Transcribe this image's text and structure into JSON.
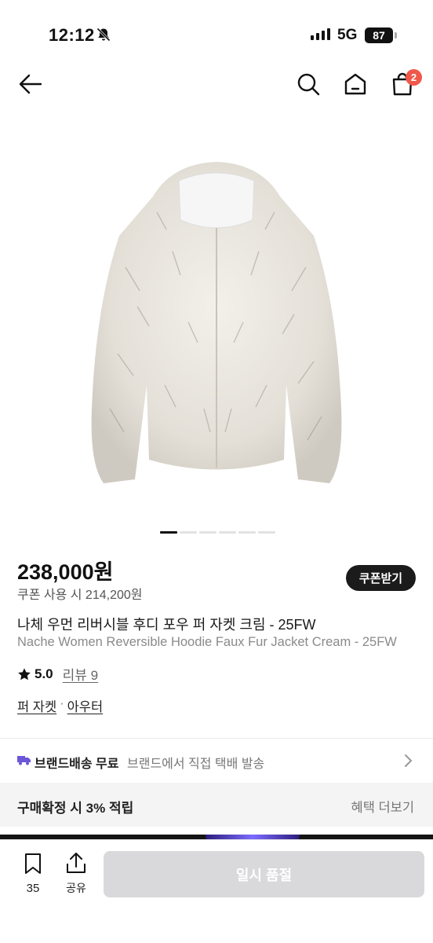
{
  "status_bar": {
    "time": "12:12",
    "network": "5G",
    "battery": "87"
  },
  "nav": {
    "cart_badge": "2"
  },
  "product": {
    "price": "238,000원",
    "coupon_price": "쿠폰 사용 시 214,200원",
    "coupon_button": "쿠폰받기",
    "title_ko": "나체 우먼 리버시블 후디 포우 퍼 자켓 크림 - 25FW",
    "title_en": "Nache Women Reversible Hoodie Faux Fur Jacket Cream - 25FW",
    "rating": "5.0",
    "review_label": "리뷰 9",
    "category_1": "퍼 자켓",
    "category_sep": "·",
    "category_2": "아우터",
    "image_pages": 6,
    "image_active_page": 1
  },
  "shipping": {
    "bold": "브랜드배송 무료",
    "sub": "브랜드에서 직접 택배 발송"
  },
  "benefit": {
    "left": "구매확정 시 3% 적립",
    "right": "혜택 더보기"
  },
  "bottom_bar": {
    "bookmark_count": "35",
    "share_label": "공유",
    "soldout_label": "일시 품절"
  },
  "colors": {
    "badge": "#f0584a",
    "dark_button": "#1b1b1b",
    "disabled_button": "#d9d9db",
    "truck": "#6b57d8"
  }
}
